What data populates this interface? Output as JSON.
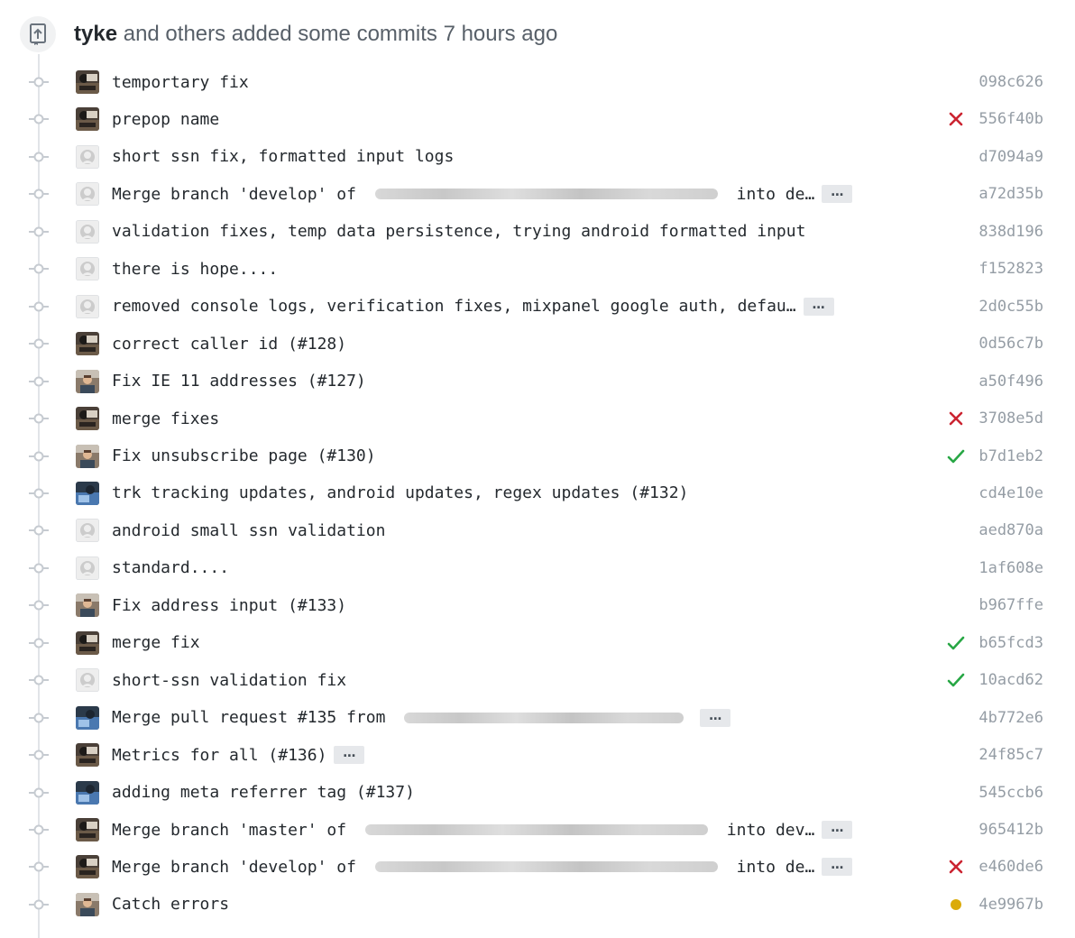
{
  "header": {
    "author": "tyke",
    "text": "and others added some commits 7 hours ago"
  },
  "colors": {
    "failure": "#cb2431",
    "success": "#28a745",
    "pending": "#dbab09",
    "sha": "#959da5"
  },
  "commits": [
    {
      "parts": [
        "temportary fix"
      ],
      "sha": "098c626",
      "status": "",
      "avatar": "dark-photo"
    },
    {
      "parts": [
        "prepop name"
      ],
      "sha": "556f40b",
      "status": "failure",
      "avatar": "dark-photo"
    },
    {
      "parts": [
        "short ssn fix, formatted input logs"
      ],
      "sha": "d7094a9",
      "status": "",
      "avatar": "default"
    },
    {
      "parts": [
        "Merge branch 'develop' of ",
        "BLUR:380",
        " into de…"
      ],
      "ellipsis": true,
      "sha": "a72d35b",
      "status": "",
      "avatar": "default"
    },
    {
      "parts": [
        "validation fixes, temp data persistence, trying android formatted input"
      ],
      "sha": "838d196",
      "status": "",
      "avatar": "default"
    },
    {
      "parts": [
        "there is hope...."
      ],
      "sha": "f152823",
      "status": "",
      "avatar": "default"
    },
    {
      "parts": [
        "removed console logs, verification fixes, mixpanel google auth, defau…"
      ],
      "ellipsis": true,
      "sha": "2d0c55b",
      "status": "",
      "avatar": "default"
    },
    {
      "parts": [
        "correct caller id (#128)"
      ],
      "sha": "0d56c7b",
      "status": "",
      "avatar": "dark-photo"
    },
    {
      "parts": [
        "Fix IE 11 addresses (#127)"
      ],
      "sha": "a50f496",
      "status": "",
      "avatar": "person"
    },
    {
      "parts": [
        "merge fixes"
      ],
      "sha": "3708e5d",
      "status": "failure",
      "avatar": "dark-photo"
    },
    {
      "parts": [
        "Fix unsubscribe page (#130)"
      ],
      "sha": "b7d1eb2",
      "status": "success",
      "avatar": "person"
    },
    {
      "parts": [
        "trk tracking updates, android updates, regex updates (#132)"
      ],
      "sha": "cd4e10e",
      "status": "",
      "avatar": "blue-photo"
    },
    {
      "parts": [
        "android small ssn validation"
      ],
      "sha": "aed870a",
      "status": "",
      "avatar": "default"
    },
    {
      "parts": [
        "standard...."
      ],
      "sha": "1af608e",
      "status": "",
      "avatar": "default"
    },
    {
      "parts": [
        "Fix address input (#133)"
      ],
      "sha": "b967ffe",
      "status": "",
      "avatar": "person"
    },
    {
      "parts": [
        "merge fix"
      ],
      "sha": "b65fcd3",
      "status": "success",
      "avatar": "dark-photo"
    },
    {
      "parts": [
        "short-ssn validation fix"
      ],
      "sha": "10acd62",
      "status": "success",
      "avatar": "default"
    },
    {
      "parts": [
        "Merge pull request #135 from ",
        "BLUR:310"
      ],
      "ellipsis": true,
      "sha": "4b772e6",
      "status": "",
      "avatar": "blue-photo"
    },
    {
      "parts": [
        "Metrics for all (#136)"
      ],
      "ellipsis": true,
      "sha": "24f85c7",
      "status": "",
      "avatar": "dark-photo"
    },
    {
      "parts": [
        "adding meta referrer tag (#137)"
      ],
      "sha": "545ccb6",
      "status": "",
      "avatar": "blue-photo"
    },
    {
      "parts": [
        "Merge branch 'master' of ",
        "BLUR:380",
        " into dev…"
      ],
      "ellipsis": true,
      "sha": "965412b",
      "status": "",
      "avatar": "dark-photo"
    },
    {
      "parts": [
        "Merge branch 'develop' of ",
        "BLUR:380",
        " into de…"
      ],
      "ellipsis": true,
      "sha": "e460de6",
      "status": "failure",
      "avatar": "dark-photo"
    },
    {
      "parts": [
        "Catch errors"
      ],
      "sha": "4e9967b",
      "status": "pending",
      "avatar": "person"
    }
  ]
}
